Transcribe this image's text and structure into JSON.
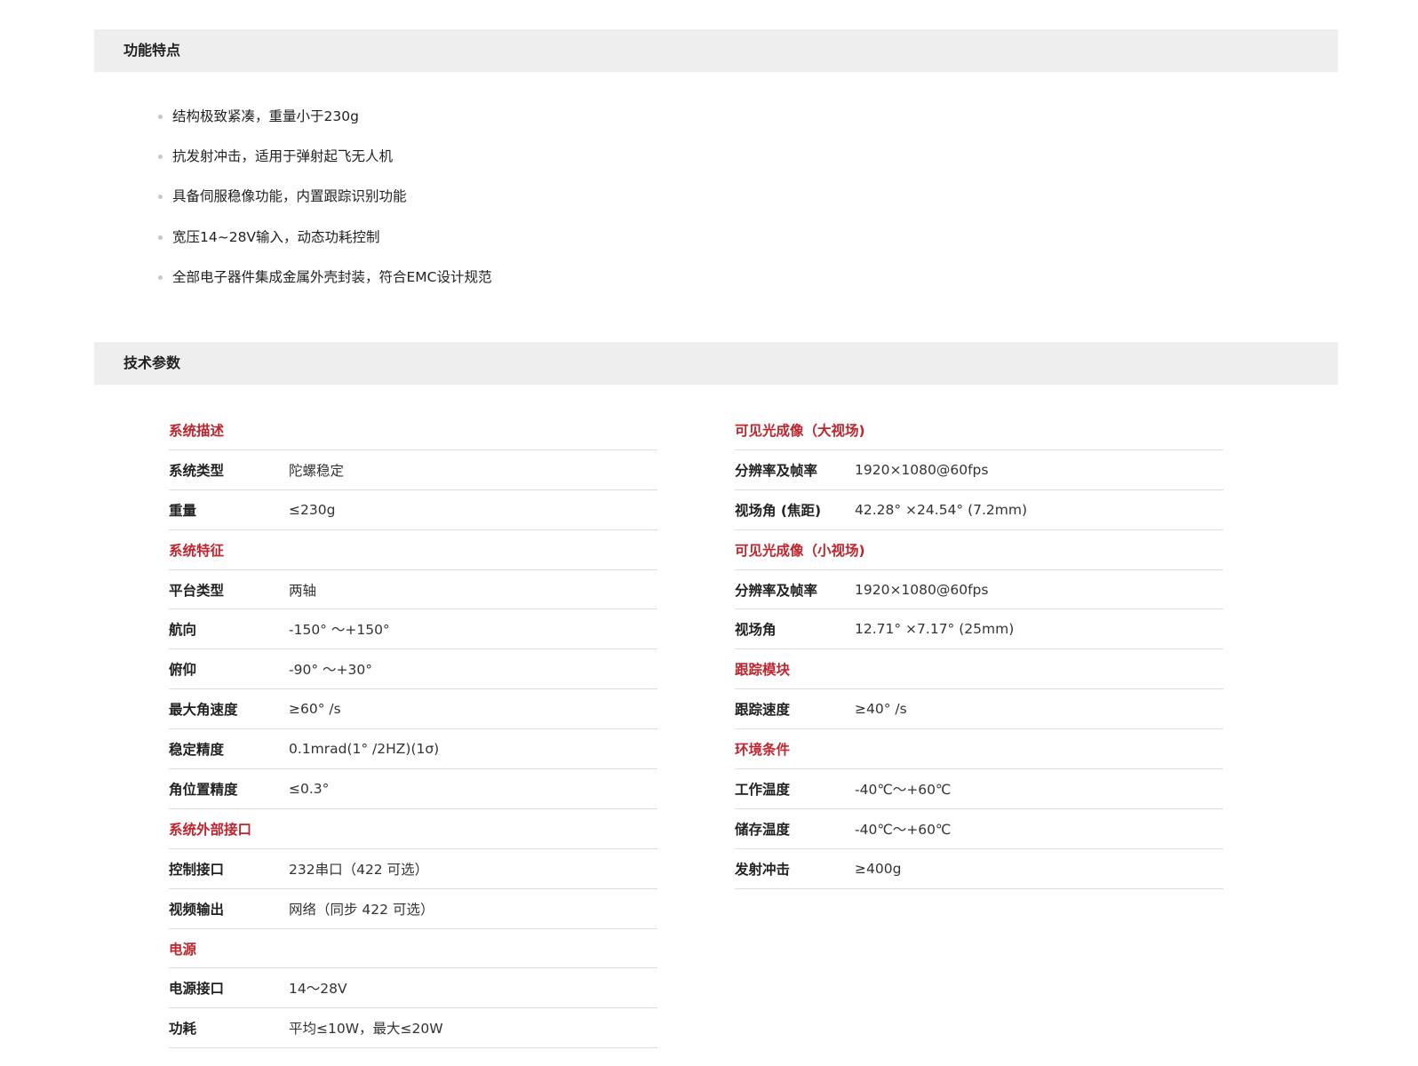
{
  "features_section": {
    "title": "功能特点",
    "items": [
      "结构极致紧凑，重量小于230g",
      "抗发射冲击，适用于弹射起飞无人机",
      "具备伺服稳像功能，内置跟踪识别功能",
      "宽压14~28V输入，动态功耗控制",
      "全部电子器件集成金属外壳封装，符合EMC设计规范"
    ]
  },
  "specs_section": {
    "title": "技术参数",
    "left": [
      {
        "type": "header",
        "label": "系统描述"
      },
      {
        "type": "row",
        "label": "系统类型",
        "value": "陀螺稳定"
      },
      {
        "type": "row",
        "label": "重量",
        "value": "≤230g"
      },
      {
        "type": "header",
        "label": "系统特征"
      },
      {
        "type": "row",
        "label": "平台类型",
        "value": "两轴"
      },
      {
        "type": "row",
        "label": "航向",
        "value": "-150° ～+150°"
      },
      {
        "type": "row",
        "label": "俯仰",
        "value": "-90° ～+30°"
      },
      {
        "type": "row",
        "label": "最大角速度",
        "value": "≥60° /s"
      },
      {
        "type": "row",
        "label": "稳定精度",
        "value": "0.1mrad(1° /2HZ)(1σ)"
      },
      {
        "type": "row",
        "label": "角位置精度",
        "value": "≤0.3°"
      },
      {
        "type": "header",
        "label": "系统外部接口"
      },
      {
        "type": "row",
        "label": "控制接口",
        "value": "232串口（422 可选）"
      },
      {
        "type": "row",
        "label": "视频输出",
        "value": "网络（同步 422 可选）"
      },
      {
        "type": "header",
        "label": "电源"
      },
      {
        "type": "row",
        "label": "电源接口",
        "value": "14～28V"
      },
      {
        "type": "row",
        "label": "功耗",
        "value": "平均≤10W，最大≤20W"
      }
    ],
    "right": [
      {
        "type": "header",
        "label": "可见光成像（大视场)"
      },
      {
        "type": "row",
        "label": "分辨率及帧率",
        "value": "1920×1080@60fps"
      },
      {
        "type": "row",
        "label": "视场角 (焦距)",
        "value": "42.28° ×24.54° (7.2mm)"
      },
      {
        "type": "header",
        "label": "可见光成像（小视场)"
      },
      {
        "type": "row",
        "label": "分辨率及帧率",
        "value": "1920×1080@60fps"
      },
      {
        "type": "row",
        "label": "视场角",
        "value": "12.71° ×7.17° (25mm)"
      },
      {
        "type": "header",
        "label": "跟踪模块"
      },
      {
        "type": "row",
        "label": "跟踪速度",
        "value": "≥40° /s"
      },
      {
        "type": "header",
        "label": "环境条件"
      },
      {
        "type": "row",
        "label": "工作温度",
        "value": "-40℃～+60℃"
      },
      {
        "type": "row",
        "label": "储存温度",
        "value": "-40℃～+60℃"
      },
      {
        "type": "row",
        "label": "发射冲击",
        "value": "≥400g"
      }
    ]
  },
  "colors": {
    "accent": "#c0242c",
    "section_bar": "#eeeeee",
    "divider": "#dddddd",
    "bullet": "#c8c8c8"
  }
}
